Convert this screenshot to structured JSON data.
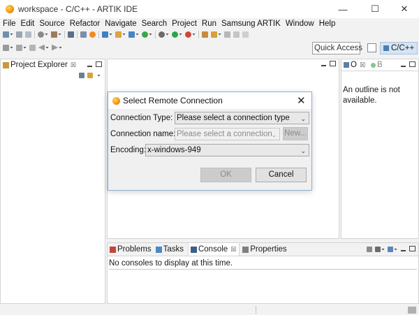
{
  "window": {
    "title": "workspace - C/C++ - ARTIK IDE",
    "minimize_glyph": "—",
    "maximize_glyph": "☐",
    "close_glyph": "✕"
  },
  "menu": [
    "File",
    "Edit",
    "Source",
    "Refactor",
    "Navigate",
    "Search",
    "Project",
    "Run",
    "Samsung ARTIK",
    "Window",
    "Help"
  ],
  "toolbar": {
    "quick_access": "Quick Access",
    "perspective_label": "C/C++"
  },
  "project_explorer": {
    "tab_label": "Project Explorer",
    "close_glyph": "☒"
  },
  "outline": {
    "tab_label": "O",
    "second_tab_label": "B",
    "close_glyph": "☒",
    "message": "An outline is not available."
  },
  "bottom_panel": {
    "tabs": [
      {
        "label": "Problems"
      },
      {
        "label": "Tasks"
      },
      {
        "label": "Console",
        "active": true
      },
      {
        "label": "Properties"
      }
    ],
    "console_message": "No consoles to display at this time."
  },
  "dialog": {
    "title": "Select Remote Connection",
    "connection_type_label": "Connection Type:",
    "connection_type_value": "Please select a connection type",
    "connection_name_label": "Connection name:",
    "connection_name_value": "Please select a connection",
    "new_button": "New...",
    "encoding_label": "Encoding:",
    "encoding_value": "x-windows-949",
    "ok_button": "OK",
    "cancel_button": "Cancel"
  },
  "colors": {
    "accent": "#8faed0",
    "perspective_bg": "#d5e4f2",
    "app_icon": "#f59a1b"
  }
}
